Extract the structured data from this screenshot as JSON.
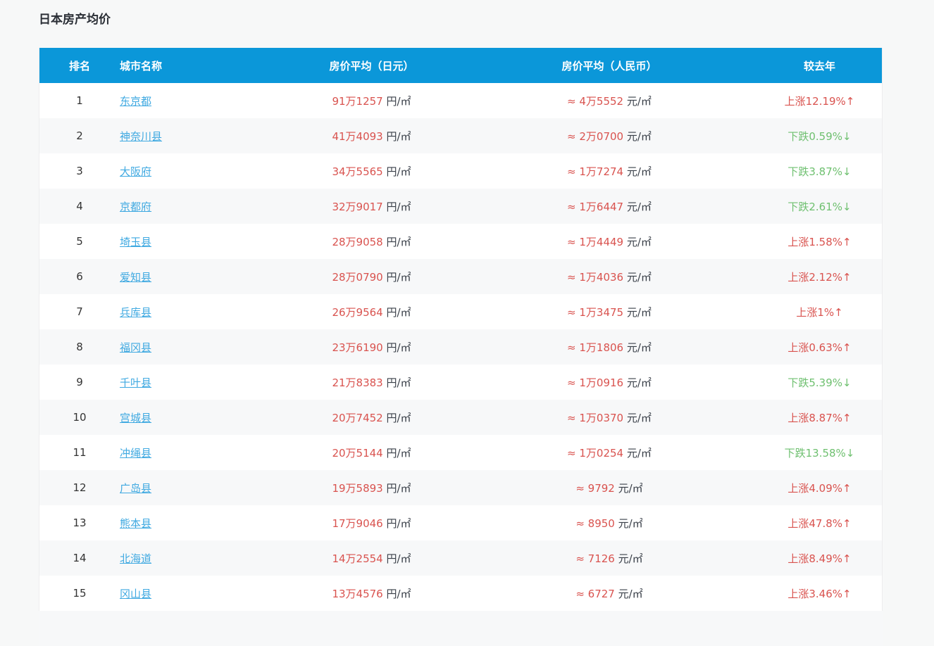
{
  "page": {
    "title": "日本房产均价"
  },
  "colors": {
    "header_bg": "#0b97d9",
    "link_blue": "#3fa9e1",
    "price_red": "#d9534f",
    "rise_red": "#d9534f",
    "fall_green": "#6fc070"
  },
  "table": {
    "columns": [
      {
        "key": "rank",
        "label": "排名"
      },
      {
        "key": "city",
        "label": "城市名称"
      },
      {
        "key": "jpy",
        "label": "房价平均（日元）"
      },
      {
        "key": "rmb",
        "label": "房价平均（人民币）"
      },
      {
        "key": "change",
        "label": "较去年"
      }
    ],
    "unit_jpy": "円/㎡",
    "unit_rmb": "元/㎡",
    "rows": [
      {
        "rank": "1",
        "city": "东京都",
        "jpy": "91万1257",
        "rmb": "≈ 4万5552",
        "change": "上涨12.19%↑",
        "trend": "up"
      },
      {
        "rank": "2",
        "city": "神奈川县",
        "jpy": "41万4093",
        "rmb": "≈ 2万0700",
        "change": "下跌0.59%↓",
        "trend": "down"
      },
      {
        "rank": "3",
        "city": "大阪府",
        "jpy": "34万5565",
        "rmb": "≈ 1万7274",
        "change": "下跌3.87%↓",
        "trend": "down"
      },
      {
        "rank": "4",
        "city": "京都府",
        "jpy": "32万9017",
        "rmb": "≈ 1万6447",
        "change": "下跌2.61%↓",
        "trend": "down"
      },
      {
        "rank": "5",
        "city": "埼玉县",
        "jpy": "28万9058",
        "rmb": "≈ 1万4449",
        "change": "上涨1.58%↑",
        "trend": "up"
      },
      {
        "rank": "6",
        "city": "爱知县",
        "jpy": "28万0790",
        "rmb": "≈ 1万4036",
        "change": "上涨2.12%↑",
        "trend": "up"
      },
      {
        "rank": "7",
        "city": "兵库县",
        "jpy": "26万9564",
        "rmb": "≈ 1万3475",
        "change": "上涨1%↑",
        "trend": "up"
      },
      {
        "rank": "8",
        "city": "福冈县",
        "jpy": "23万6190",
        "rmb": "≈ 1万1806",
        "change": "上涨0.63%↑",
        "trend": "up"
      },
      {
        "rank": "9",
        "city": "千叶县",
        "jpy": "21万8383",
        "rmb": "≈ 1万0916",
        "change": "下跌5.39%↓",
        "trend": "down"
      },
      {
        "rank": "10",
        "city": "宫城县",
        "jpy": "20万7452",
        "rmb": "≈ 1万0370",
        "change": "上涨8.87%↑",
        "trend": "up"
      },
      {
        "rank": "11",
        "city": "冲绳县",
        "jpy": "20万5144",
        "rmb": "≈ 1万0254",
        "change": "下跌13.58%↓",
        "trend": "down"
      },
      {
        "rank": "12",
        "city": "广岛县",
        "jpy": "19万5893",
        "rmb": "≈ 9792",
        "change": "上涨4.09%↑",
        "trend": "up"
      },
      {
        "rank": "13",
        "city": "熊本县",
        "jpy": "17万9046",
        "rmb": "≈ 8950",
        "change": "上涨47.8%↑",
        "trend": "up"
      },
      {
        "rank": "14",
        "city": "北海道",
        "jpy": "14万2554",
        "rmb": "≈ 7126",
        "change": "上涨8.49%↑",
        "trend": "up"
      },
      {
        "rank": "15",
        "city": "冈山县",
        "jpy": "13万4576",
        "rmb": "≈ 6727",
        "change": "上涨3.46%↑",
        "trend": "up"
      }
    ]
  }
}
